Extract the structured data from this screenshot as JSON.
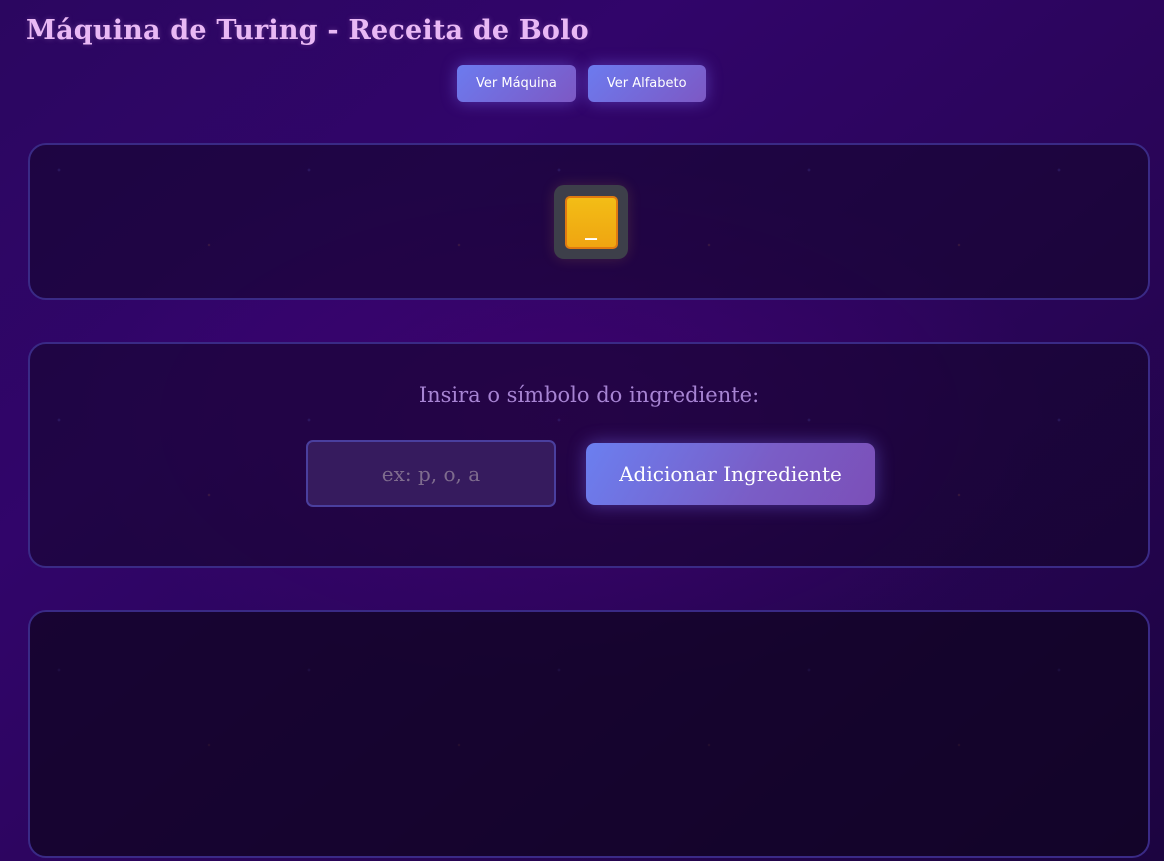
{
  "header": {
    "title": "Máquina de Turing - Receita de Bolo"
  },
  "nav": {
    "view_machine_label": "Ver Máquina",
    "view_alphabet_label": "Ver Alfabeto"
  },
  "tape": {
    "cells": [
      "_"
    ]
  },
  "ingredient_form": {
    "prompt": "Insira o símbolo do ingrediente:",
    "input_value": "",
    "input_placeholder": "ex: p, o, a",
    "submit_label": "Adicionar Ingrediente"
  },
  "colors": {
    "accent_start": "#6c7bef",
    "accent_end": "#7d58c4",
    "tape_cell": "#f3bd16",
    "title": "#e9b8f5"
  }
}
